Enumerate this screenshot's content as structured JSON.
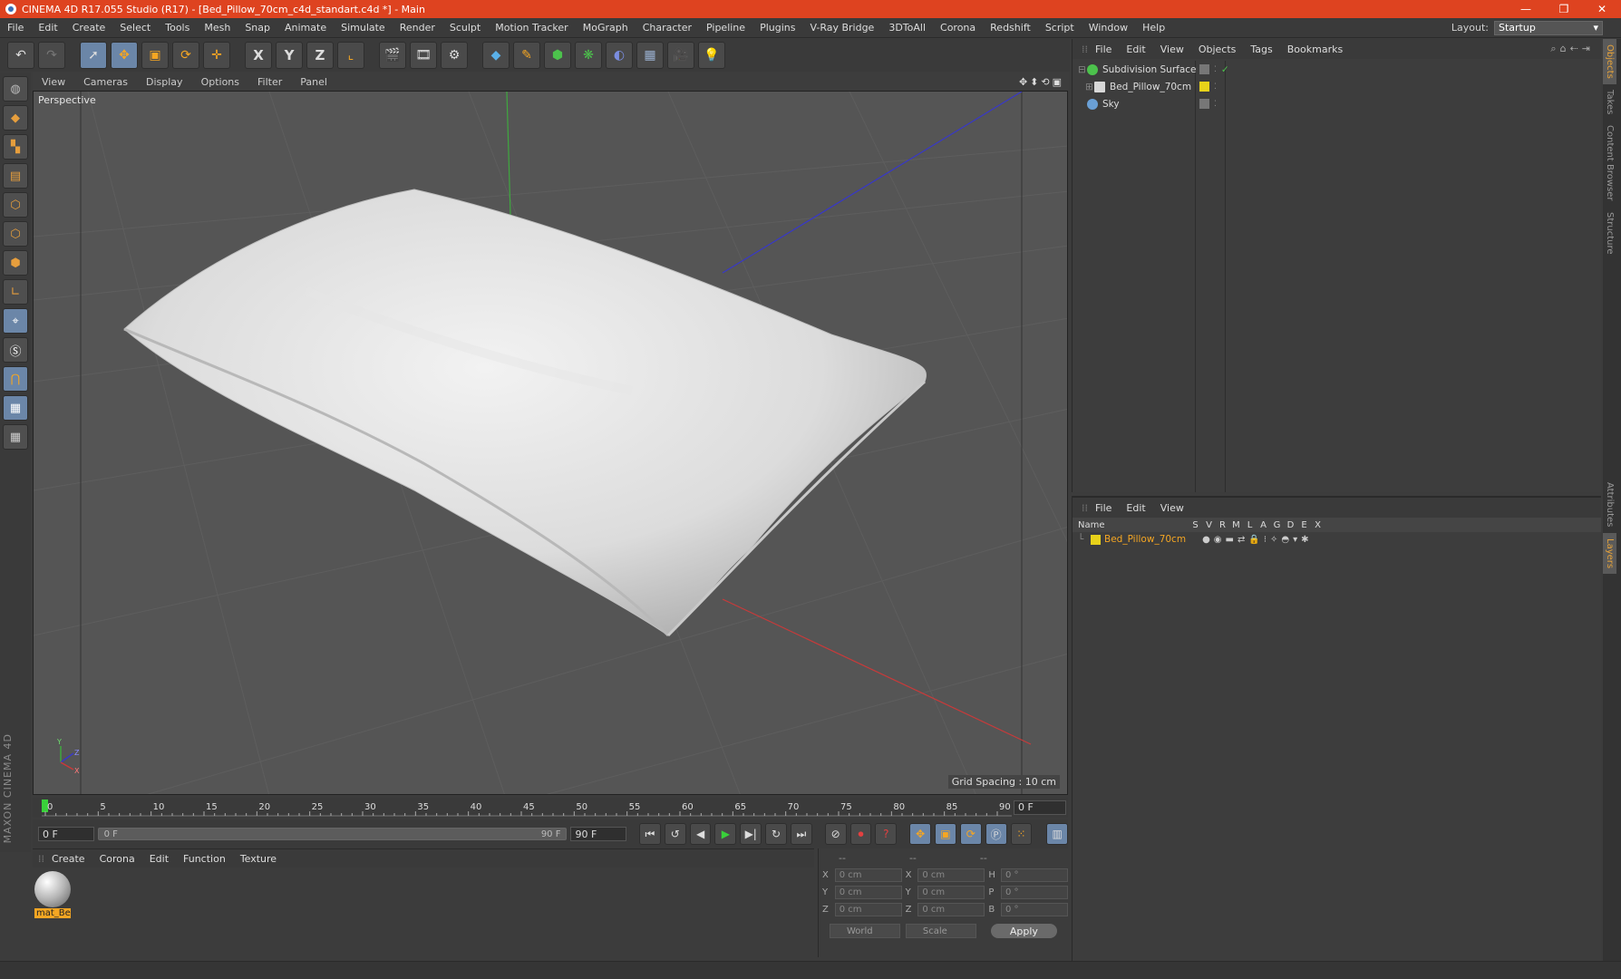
{
  "window": {
    "title": "CINEMA 4D R17.055 Studio (R17) - [Bed_Pillow_70cm_c4d_standart.c4d *] - Main",
    "controls": [
      "—",
      "❐",
      "✕"
    ]
  },
  "menubar": {
    "items": [
      "File",
      "Edit",
      "Create",
      "Select",
      "Tools",
      "Mesh",
      "Snap",
      "Animate",
      "Simulate",
      "Render",
      "Sculpt",
      "Motion Tracker",
      "MoGraph",
      "Character",
      "Pipeline",
      "Plugins",
      "V-Ray Bridge",
      "3DToAll",
      "Corona",
      "Redshift",
      "Script",
      "Window",
      "Help"
    ],
    "layout_label": "Layout:",
    "layout_value": "Startup"
  },
  "toolbar": {
    "undo_icon": "↶",
    "redo_icon": "↷",
    "axis_x": "X",
    "axis_y": "Y",
    "axis_z": "Z"
  },
  "viewport": {
    "menu": [
      "View",
      "Cameras",
      "Display",
      "Options",
      "Filter",
      "Panel"
    ],
    "nav_icons": "✥⬍⟲▣",
    "camera_label": "Perspective",
    "grid_spacing": "Grid Spacing : 10 cm",
    "axis_y_label": "Y",
    "axis_z_label": "Z",
    "axis_x_label": "X"
  },
  "timeline": {
    "ticks": [
      "0",
      "5",
      "10",
      "15",
      "20",
      "25",
      "30",
      "35",
      "40",
      "45",
      "50",
      "55",
      "60",
      "65",
      "70",
      "75",
      "80",
      "85",
      "90"
    ],
    "current_frame": "0 F",
    "start_field": "0 F",
    "slider_start": "0 F",
    "slider_end": "90 F",
    "end_field": "90 F"
  },
  "material_manager": {
    "menu": [
      "Create",
      "Corona",
      "Edit",
      "Function",
      "Texture"
    ],
    "material_name": "mat_Bed"
  },
  "coordinates": {
    "headers": [
      "--",
      "--",
      "--"
    ],
    "rows": [
      {
        "a": "X",
        "av": "0 cm",
        "b": "X",
        "bv": "0 cm",
        "c": "H",
        "cv": "0 °"
      },
      {
        "a": "Y",
        "av": "0 cm",
        "b": "Y",
        "bv": "0 cm",
        "c": "P",
        "cv": "0 °"
      },
      {
        "a": "Z",
        "av": "0 cm",
        "b": "Z",
        "bv": "0 cm",
        "c": "B",
        "cv": "0 °"
      }
    ],
    "world": "World",
    "scale": "Scale",
    "apply": "Apply"
  },
  "object_manager": {
    "menu": [
      "File",
      "Edit",
      "View",
      "Objects",
      "Tags",
      "Bookmarks"
    ],
    "objects": [
      {
        "name": "Subdivision Surface",
        "color": "#4cc24c",
        "layer_color": ""
      },
      {
        "name": "Bed_Pillow_70cm",
        "color": "#d8d8d8",
        "layer_color": "#e8d21a"
      },
      {
        "name": "Sky",
        "color": "#6aa0d6",
        "layer_color": ""
      }
    ]
  },
  "layer_manager": {
    "menu": [
      "File",
      "Edit",
      "View"
    ],
    "columns": [
      "Name",
      "S",
      "V",
      "R",
      "M",
      "L",
      "A",
      "G",
      "D",
      "E",
      "X"
    ],
    "layers": [
      {
        "name": "Bed_Pillow_70cm",
        "color": "#e8d21a"
      }
    ]
  },
  "side_tabs": [
    "Objects",
    "Takes",
    "Content Browser",
    "Structure",
    "Attributes",
    "Layers"
  ],
  "brand": "MAXON CINEMA 4D",
  "colors": {
    "title_bar": "#de4320",
    "accent_orange": "#f5a623",
    "selected_tool": "#6b86a8"
  }
}
